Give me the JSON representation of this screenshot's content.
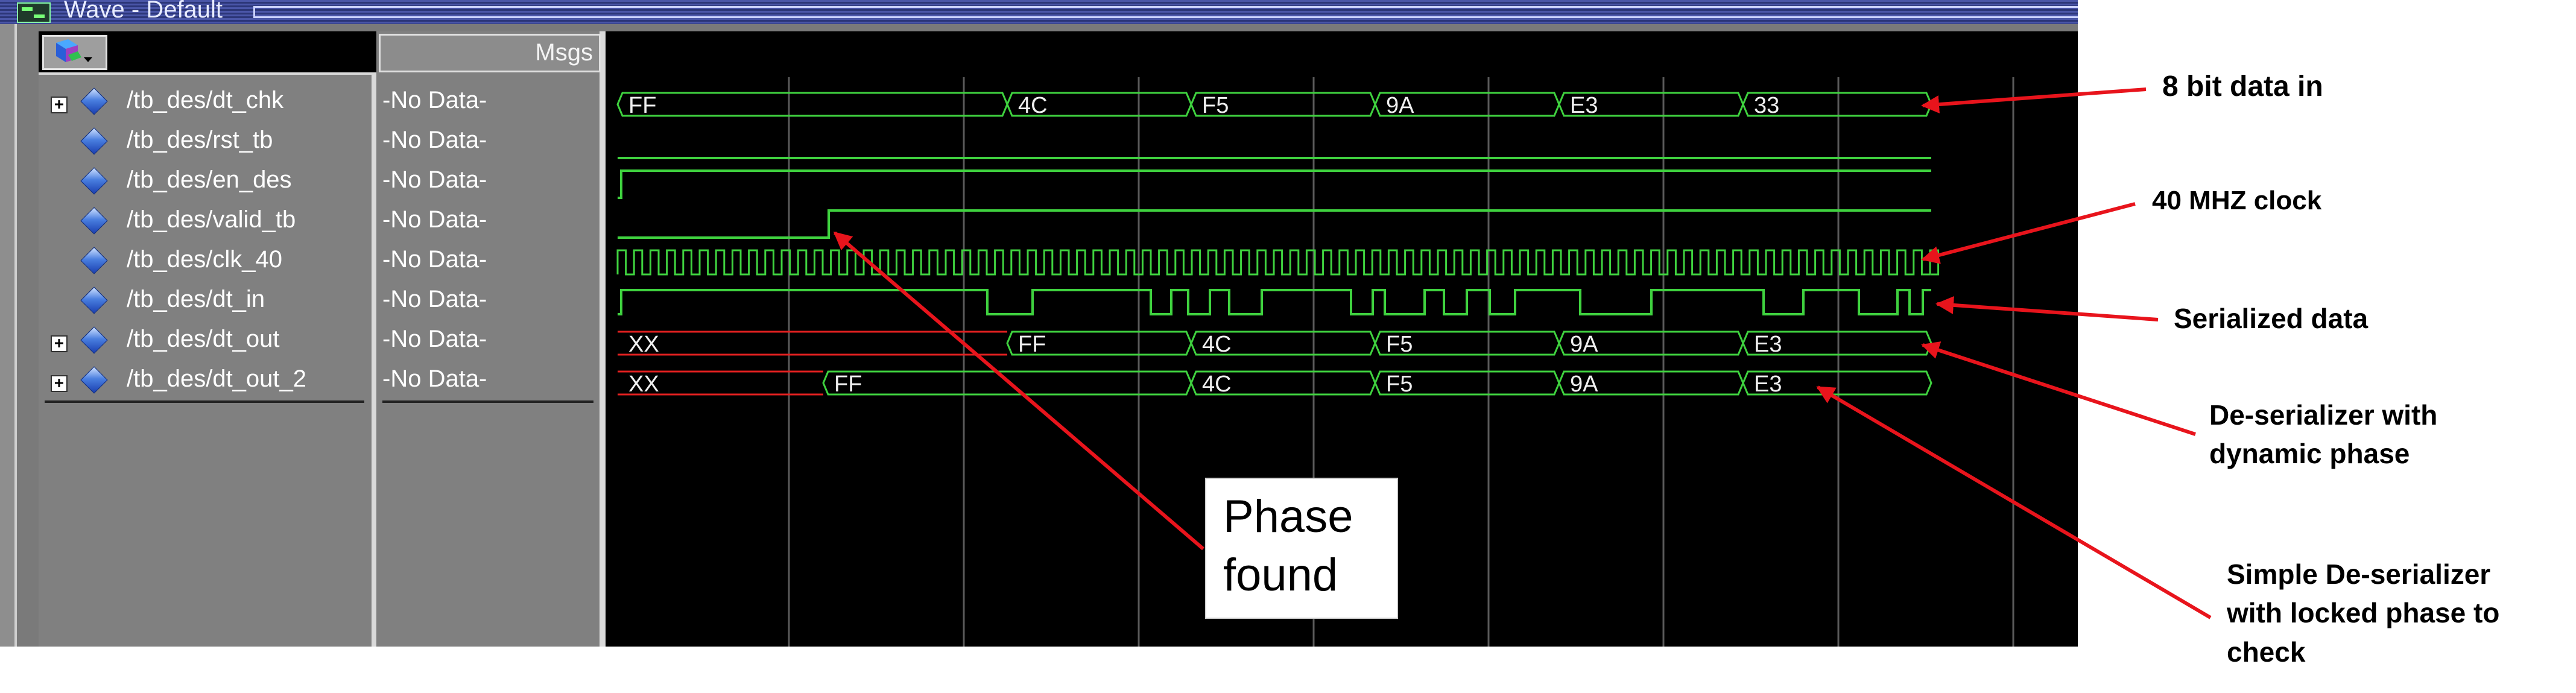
{
  "window": {
    "title": "Wave - Default"
  },
  "header": {
    "msgs_label": "Msgs"
  },
  "signals": [
    {
      "name": "/tb_des/dt_chk",
      "value": "-No Data-",
      "expandable": true
    },
    {
      "name": "/tb_des/rst_tb",
      "value": "-No Data-",
      "expandable": false
    },
    {
      "name": "/tb_des/en_des",
      "value": "-No Data-",
      "expandable": false
    },
    {
      "name": "/tb_des/valid_tb",
      "value": "-No Data-",
      "expandable": false
    },
    {
      "name": "/tb_des/clk_40",
      "value": "-No Data-",
      "expandable": false
    },
    {
      "name": "/tb_des/dt_in",
      "value": "-No Data-",
      "expandable": false
    },
    {
      "name": "/tb_des/dt_out",
      "value": "-No Data-",
      "expandable": true
    },
    {
      "name": "/tb_des/dt_out_2",
      "value": "-No Data-",
      "expandable": true
    }
  ],
  "bus_values": {
    "dt_chk": [
      "FF",
      "4C",
      "F5",
      "9A",
      "E3",
      "33"
    ],
    "dt_out": [
      "XX",
      "FF",
      "4C",
      "F5",
      "9A",
      "E3"
    ],
    "dt_out_2": [
      "XX",
      "FF",
      "4C",
      "F5",
      "9A",
      "E3"
    ]
  },
  "annotations": {
    "data_in": "8 bit data in",
    "clock": "40 MHZ clock",
    "serialized": "Serialized data",
    "deser_dynamic": "De-serializer with\ndynamic phase",
    "deser_simple": "Simple De-serializer\nwith locked phase to\ncheck",
    "phase_found": "Phase\nfound"
  },
  "colors": {
    "wave": "#3fd23f",
    "undefined": "#e22020",
    "arrow": "#e8141c",
    "grid": "#5a5a5a"
  }
}
